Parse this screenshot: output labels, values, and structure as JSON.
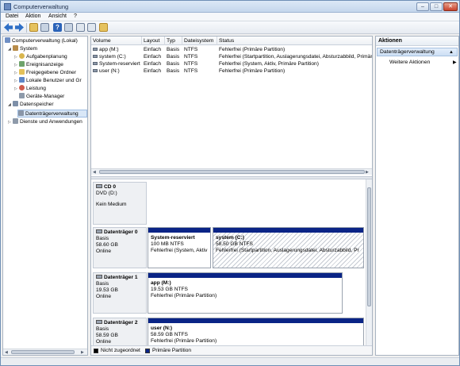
{
  "window": {
    "title": "Computerverwaltung"
  },
  "menu": [
    "Datei",
    "Aktion",
    "Ansicht",
    "?"
  ],
  "tree": {
    "root": "Computerverwaltung (Lokal)",
    "items": [
      {
        "label": "System",
        "level": 1,
        "expanded": true,
        "icon": "tools-icon"
      },
      {
        "label": "Aufgabenplanung",
        "level": 2,
        "icon": "clock-icon"
      },
      {
        "label": "Ereignisanzeige",
        "level": 2,
        "icon": "event-viewer-icon"
      },
      {
        "label": "Freigegebene Ordner",
        "level": 2,
        "icon": "shared-folder-icon"
      },
      {
        "label": "Lokale Benutzer und Gr",
        "level": 2,
        "icon": "users-icon"
      },
      {
        "label": "Leistung",
        "level": 2,
        "icon": "performance-icon"
      },
      {
        "label": "Geräte-Manager",
        "level": 2,
        "icon": "device-manager-icon"
      },
      {
        "label": "Datenspeicher",
        "level": 1,
        "expanded": true,
        "icon": "storage-icon"
      },
      {
        "label": "Datenträgerverwaltung",
        "level": 2,
        "selected": true,
        "icon": "disk-management-icon"
      },
      {
        "label": "Dienste und Anwendungen",
        "level": 1,
        "icon": "services-icon"
      }
    ]
  },
  "volumes": {
    "columns": [
      "Volume",
      "Layout",
      "Typ",
      "Dateisystem",
      "Status"
    ],
    "rows": [
      [
        "app (M:)",
        "Einfach",
        "Basis",
        "NTFS",
        "Fehlerfrei (Primäre Partition)"
      ],
      [
        "system (C:)",
        "Einfach",
        "Basis",
        "NTFS",
        "Fehlerfrei (Startpartition, Auslagerungsdatei, Absturzabbild, Primäre Partition)"
      ],
      [
        "System-reserviert",
        "Einfach",
        "Basis",
        "NTFS",
        "Fehlerfrei (System, Aktiv, Primäre Partition)"
      ],
      [
        "user (N:)",
        "Einfach",
        "Basis",
        "NTFS",
        "Fehlerfrei (Primäre Partition)"
      ]
    ]
  },
  "disks": {
    "cd0": {
      "name": "CD 0",
      "type": "DVD (D:)",
      "status": "Kein Medium"
    },
    "disk0": {
      "name": "Datenträger 0",
      "type": "Basis",
      "size": "58.60 GB",
      "state": "Online",
      "p1": {
        "name": "System-reserviert",
        "size": "100 MB NTFS",
        "status": "Fehlerfrei (System, Aktiv"
      },
      "p2": {
        "name": "system  (C:)",
        "size": "58.50 GB NTFS",
        "status": "Fehlerfrei (Startpartition, Auslagerungsdatei, Absturzabbild, Pr"
      }
    },
    "disk1": {
      "name": "Datenträger 1",
      "type": "Basis",
      "size": "19.53 GB",
      "state": "Online",
      "p1": {
        "name": "app  (M:)",
        "size": "19.53 GB NTFS",
        "status": "Fehlerfrei (Primäre Partition)"
      }
    },
    "disk2": {
      "name": "Datenträger 2",
      "type": "Basis",
      "size": "58.59 GB",
      "state": "Online",
      "p1": {
        "name": "user  (N:)",
        "size": "58.59 GB NTFS",
        "status": "Fehlerfrei (Primäre Partition)"
      }
    }
  },
  "legend": {
    "unallocated": "Nicht zugeordnet",
    "primary": "Primäre Partition"
  },
  "actions": {
    "header": "Aktionen",
    "section": "Datenträgerverwaltung",
    "more": "Weitere Aktionen"
  },
  "colors": {
    "primary_partition": "#0a2486",
    "unallocated": "#000000",
    "selection": "#d9e7f7"
  }
}
